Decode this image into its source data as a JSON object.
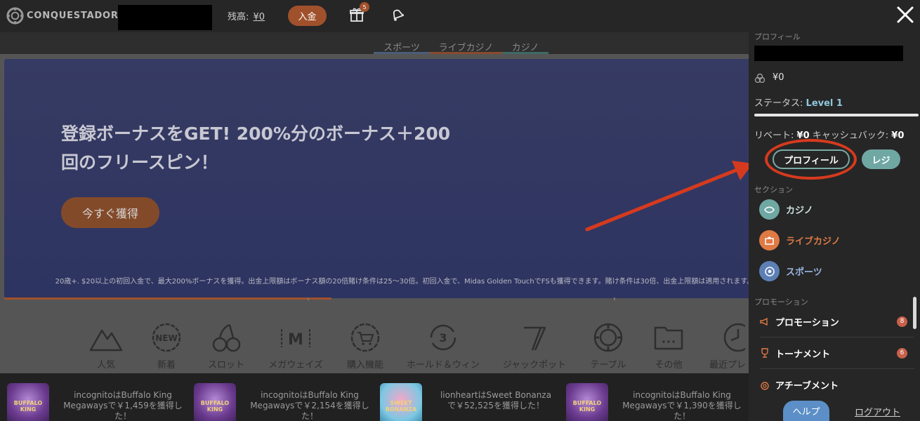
{
  "header": {
    "brand": "CONQUESTADOR",
    "balance_label": "残高:",
    "balance_value": "¥0",
    "deposit_label": "入金",
    "gift_count": "5"
  },
  "subnav": {
    "tabs": [
      {
        "label": "スポーツ"
      },
      {
        "label": "ライブカジノ"
      },
      {
        "label": "カジノ"
      }
    ]
  },
  "banner": {
    "title": "登録ボーナスをGET! 200%分のボーナス＋200回のフリースピン！",
    "cta": "今すぐ獲得",
    "terms": "20歳+. $20以上の初回入金で、最大200%ボーナスを獲得。出金上限額はボーナス額の20倍賭け条件は25〜30倍。初回入金で、Midas Golden TouchでFSも獲得できます。賭け条件は30倍、出金上限額は適用されます。"
  },
  "categories": [
    {
      "label": "人気",
      "icon": "mountain-icon"
    },
    {
      "label": "新着",
      "icon": "new-badge-icon"
    },
    {
      "label": "スロット",
      "icon": "cherry-icon"
    },
    {
      "label": "メガウェイズ",
      "icon": "megaways-icon"
    },
    {
      "label": "購入機能",
      "icon": "cart-icon"
    },
    {
      "label": "ホールド＆ウィン",
      "icon": "hold-win-icon"
    },
    {
      "label": "ジャックポット",
      "icon": "seven-icon"
    },
    {
      "label": "テーブル",
      "icon": "chip-icon"
    },
    {
      "label": "その他",
      "icon": "folder-icon"
    },
    {
      "label": "最近プレ",
      "icon": "clock-icon"
    }
  ],
  "ticker": [
    {
      "game": "BUFFALO KING",
      "text": "incognitoはBuffalo King Megawaysで￥1,459を獲得した！"
    },
    {
      "game": "BUFFALO KING",
      "text": "incognitoはBuffalo King Megawaysで￥2,154を獲得した！"
    },
    {
      "game": "SWEET BONANZA",
      "text": "lionheartはSweet Bonanzaで￥52,525を獲得した！"
    },
    {
      "game": "BUFFALO KING",
      "text": "incognitoはBuffalo King Megawaysで￥1,390を獲得した！"
    }
  ],
  "drawer": {
    "profile_label": "プロフィール",
    "wallet_value": "¥0",
    "status_label": "ステータス:",
    "status_value": "Level 1",
    "rebate_label": "リベート:",
    "rebate_value": "¥0",
    "cashback_label": "キャッシュバック:",
    "cashback_value": "¥0",
    "profile_button": "プロフィール",
    "cashier_button": "レジ",
    "sections_label": "セクション",
    "sections": [
      {
        "label": "カジノ",
        "color": "#6fa7a3"
      },
      {
        "label": "ライブカジノ",
        "color": "#e07a45"
      },
      {
        "label": "スポーツ",
        "color": "#5c7fb5"
      }
    ],
    "promotions_label": "プロモーション",
    "promotions": [
      {
        "label": "プロモーション",
        "badge": "8",
        "icon": "megaphone-icon"
      },
      {
        "label": "トーナメント",
        "badge": "6",
        "icon": "trophy-icon"
      },
      {
        "label": "アチーブメント",
        "badge": "",
        "icon": "medal-icon"
      }
    ],
    "help_button": "ヘルプ",
    "logout_link": "ログアウト"
  },
  "colors": {
    "accent_orange": "#a0512c",
    "teal": "#6fa7a3",
    "annotation_red": "#d63a1e"
  }
}
